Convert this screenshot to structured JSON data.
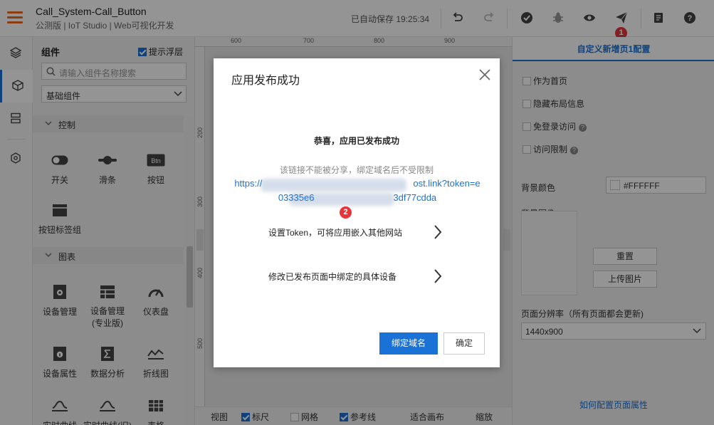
{
  "header": {
    "app_title": "Call_System-Call_Button",
    "app_subtitle": "公测版 | IoT Studio | Web可视化开发",
    "autosave": "已自动保存 19:25:34",
    "badge1": "1"
  },
  "left_panel": {
    "title": "组件",
    "float_tip_label": "提示浮层",
    "search_placeholder": "请输入组件名称搜索",
    "category_select": "基础组件",
    "categories": [
      {
        "name": "控制",
        "items": [
          {
            "label": "开关",
            "icon": "toggle-icon"
          },
          {
            "label": "滑条",
            "icon": "slider-icon"
          },
          {
            "label": "按钮",
            "icon": "btn-icon"
          },
          {
            "label": "按钮标签组",
            "icon": "button-group-icon"
          }
        ]
      },
      {
        "name": "图表",
        "items": [
          {
            "label": "设备管理",
            "icon": "device-manage-icon"
          },
          {
            "label": "设备管理\n(专业版)",
            "icon": "table-grid-icon"
          },
          {
            "label": "仪表盘",
            "icon": "gauge-icon"
          },
          {
            "label": "设备属性",
            "icon": "device-attr-icon"
          },
          {
            "label": "数据分析",
            "icon": "sigma-icon"
          },
          {
            "label": "折线图",
            "icon": "line-chart-icon"
          },
          {
            "label": "实时曲线",
            "icon": "realtime-curve-icon"
          },
          {
            "label": "实时曲线(旧)",
            "icon": "realtime-curve-old-icon"
          },
          {
            "label": "表格",
            "icon": "table-icon"
          }
        ]
      }
    ]
  },
  "canvas": {
    "ruler_h": [
      "600",
      "700",
      "800",
      "900"
    ],
    "ruler_v": [
      "200",
      "300",
      "400",
      "500"
    ]
  },
  "bottom_bar": {
    "view": "视图",
    "ruler": "标尺",
    "grid": "网格",
    "guides": "参考线",
    "fit": "适合画布",
    "zoom": "缩放"
  },
  "right_panel": {
    "title": "自定义新增页1配置",
    "checks": [
      {
        "label": "作为首页",
        "help": false
      },
      {
        "label": "隐藏布局信息",
        "help": false
      },
      {
        "label": "免登录访问",
        "help": true
      },
      {
        "label": "访问限制",
        "help": true
      }
    ],
    "bg_color_label": "背景颜色",
    "bg_color_value": "#FFFFFF",
    "bg_image_label": "背景图像",
    "reset_btn": "重置",
    "upload_btn": "上传图片",
    "resolution_label": "页面分辨率（所有页面都会更新)",
    "resolution_value": "1440x900",
    "help_link": "如何配置页面属性"
  },
  "dialog": {
    "title": "应用发布成功",
    "congrats": "恭喜，应用已发布成功",
    "note": "该链接不能被分享，绑定域名后不受限制",
    "link_line1_start": "https://",
    "link_line1_end": "ost.link?token=e",
    "link_line2_start": "03335e6",
    "link_line2_end": "3df77cdda",
    "badge2": "2",
    "row1": "设置Token，可将应用嵌入其他网站",
    "row2": "修改已发布页面中绑定的具体设备",
    "bind_domain_btn": "绑定域名",
    "ok_btn": "确定"
  },
  "colors": {
    "accent": "#1a72d6",
    "menu": "#f06a1c",
    "badge": "#e5343a"
  }
}
